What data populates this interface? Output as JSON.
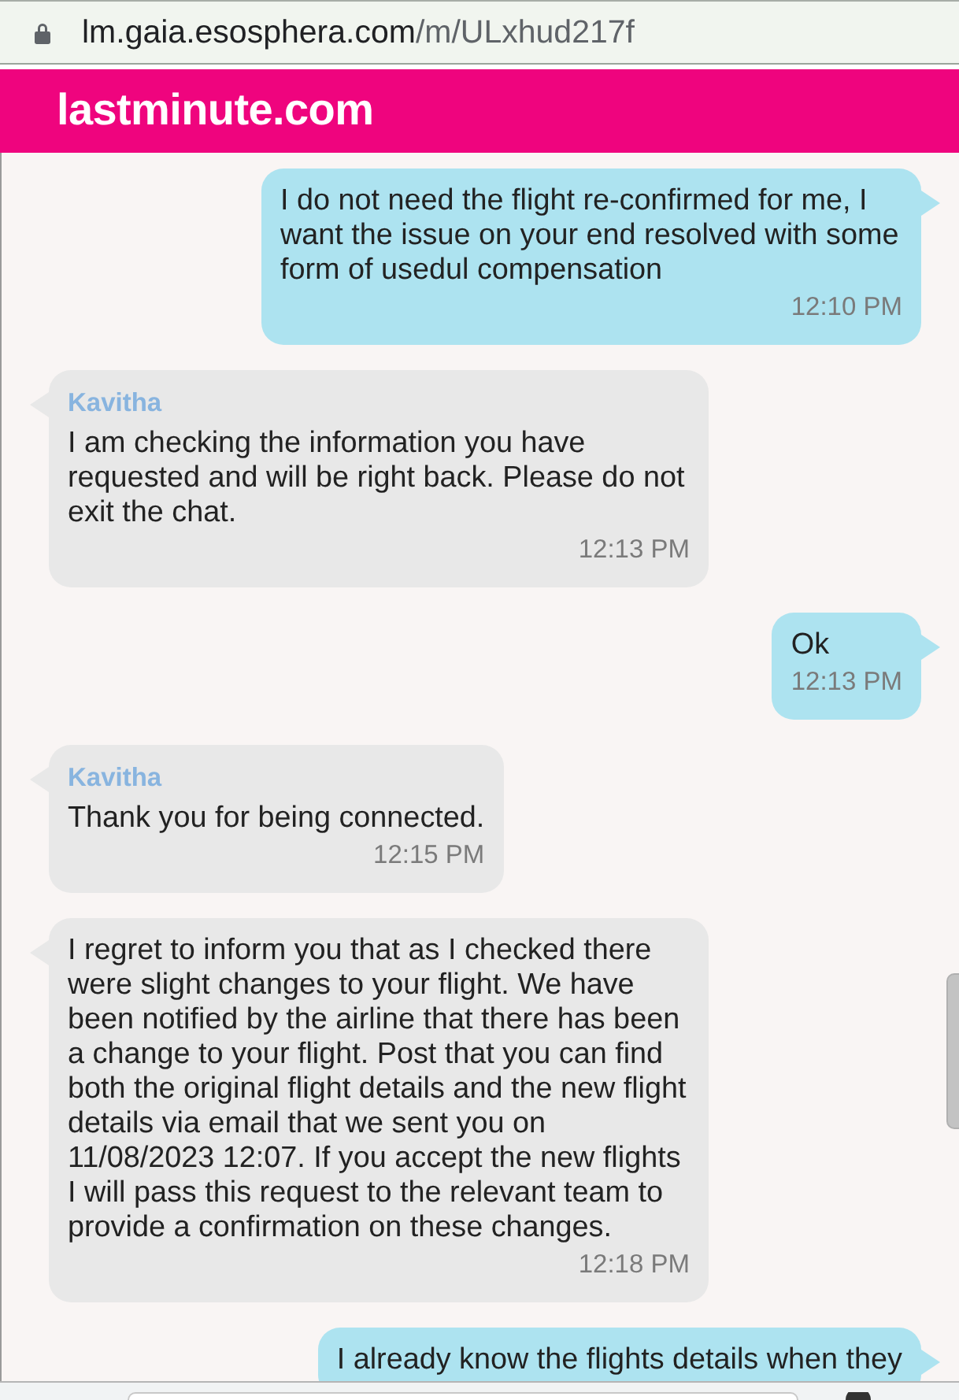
{
  "address_bar": {
    "host": "lm.gaia.esosphera.com",
    "path": "/m/ULxhud217f"
  },
  "header": {
    "logo": "lastminute.com"
  },
  "messages": [
    {
      "kind": "sent",
      "text": "I do not need the flight re-confirmed for me, I want the issue on your end resolved with some form of usedul compensation",
      "time": "12:10 PM"
    },
    {
      "kind": "received",
      "sender": "Kavitha",
      "text": "I am checking the information you have requested and will be right back. Please do not exit the chat.",
      "time": "12:13 PM"
    },
    {
      "kind": "sent",
      "text": "Ok",
      "time": "12:13 PM"
    },
    {
      "kind": "received",
      "sender": "Kavitha",
      "text": "Thank you for being connected.",
      "time": "12:15 PM"
    },
    {
      "kind": "received",
      "text": "I regret to inform you that as I checked there were slight changes to your flight. We have been notified by the airline that there has been a change to your flight. Post that you can find both the original flight details and the new flight details via email that we sent you on 11/08/2023 12:07. If you accept the new flights I will pass this request to the relevant team to provide a confirmation on these changes.",
      "time": "12:18 PM"
    },
    {
      "kind": "sent",
      "text": "I already know the flights details when they"
    }
  ]
}
